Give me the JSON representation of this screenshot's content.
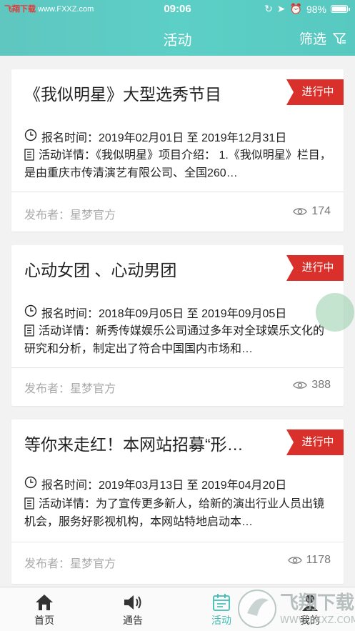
{
  "status_bar": {
    "brand": "飞翔下载",
    "brand_url": "www.FXXZ.com",
    "time": "09:06",
    "battery": "98%"
  },
  "header": {
    "title": "活动",
    "filter_label": "筛选"
  },
  "cards": [
    {
      "title": "《我似明星》大型选秀节目",
      "status": "进行中",
      "signup": "报名时间：2019年02月01日 至 2019年12月31日",
      "detail": "活动详情：《我似明星》项目介绍：    1.《我似明星》栏目，是由重庆市传清演艺有限公司、全国260…",
      "publisher": "发布者：星梦官方",
      "views": "174"
    },
    {
      "title": "心动女团 、心动男团",
      "status": "进行中",
      "signup": "报名时间：2018年09月05日 至 2019年09月05日",
      "detail": "活动详情：新秀传媒娱乐公司通过多年对全球娱乐文化的研究和分析，制定出了符合中国国内市场和…",
      "publisher": "发布者：星梦官方",
      "views": "388"
    },
    {
      "title": "等你来走红！本网站招募“形…",
      "status": "进行中",
      "signup": "报名时间：2019年03月13日 至 2019年04月20日",
      "detail": "活动详情：为了宣传更多新人，给新的演出行业人员出镜机会，服务好影视机构，本网站特地启动本…",
      "publisher": "发布者：星梦官方",
      "views": "1178"
    }
  ],
  "tabbar": {
    "tabs": [
      {
        "label": "首页",
        "icon": "home-icon"
      },
      {
        "label": "通告",
        "icon": "speaker-icon"
      },
      {
        "label": "活动",
        "icon": "calendar-icon",
        "active": true
      },
      {
        "label": "我的",
        "icon": "user-icon"
      }
    ]
  },
  "watermark": {
    "text": "飞翔下载",
    "url": "WWW.FXXZ.COM"
  },
  "colors": {
    "accent": "#5ccfc6",
    "ribbon": "#d9302b",
    "active_tab": "#3fbcb3"
  }
}
